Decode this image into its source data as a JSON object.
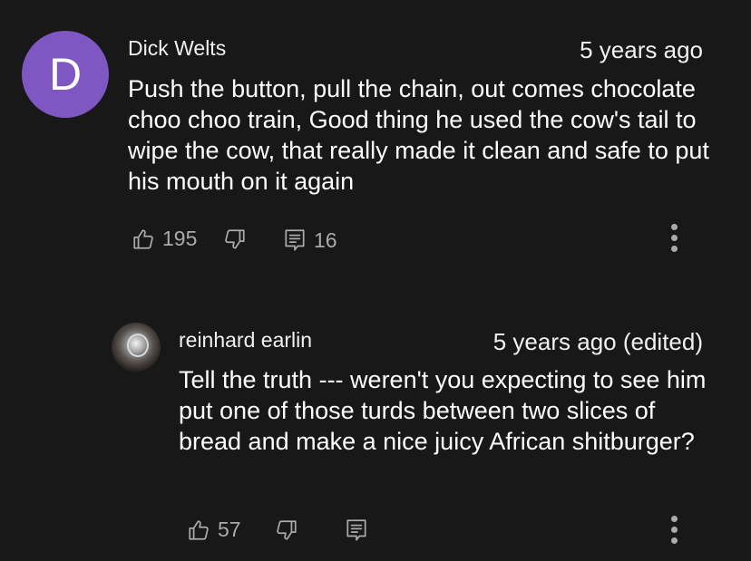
{
  "comments": [
    {
      "author": "Dick Welts",
      "avatar_letter": "D",
      "avatar_color": "#7e57c2",
      "timestamp": "5 years ago",
      "text": "Push the button, pull the chain, out comes chocolate choo choo train, Good thing he used the cow's tail to wipe the cow, that really made it clean and safe to put his mouth on it again",
      "likes": "195",
      "replies": "16"
    },
    {
      "author": "reinhard earlin",
      "avatar_icon": "avatar-photo",
      "timestamp": "5 years ago (edited)",
      "text": "Tell the truth --- weren't you expecting to see him put one of those turds between two slices of bread and make a nice juicy African shitburger?",
      "likes": "57"
    }
  ],
  "icons": {
    "like": "thumbs-up-icon",
    "dislike": "thumbs-down-icon",
    "reply": "comment-icon",
    "more": "more-vertical-icon"
  },
  "colors": {
    "background": "#181818",
    "text": "#ffffff",
    "secondary": "#aaaaaa"
  }
}
